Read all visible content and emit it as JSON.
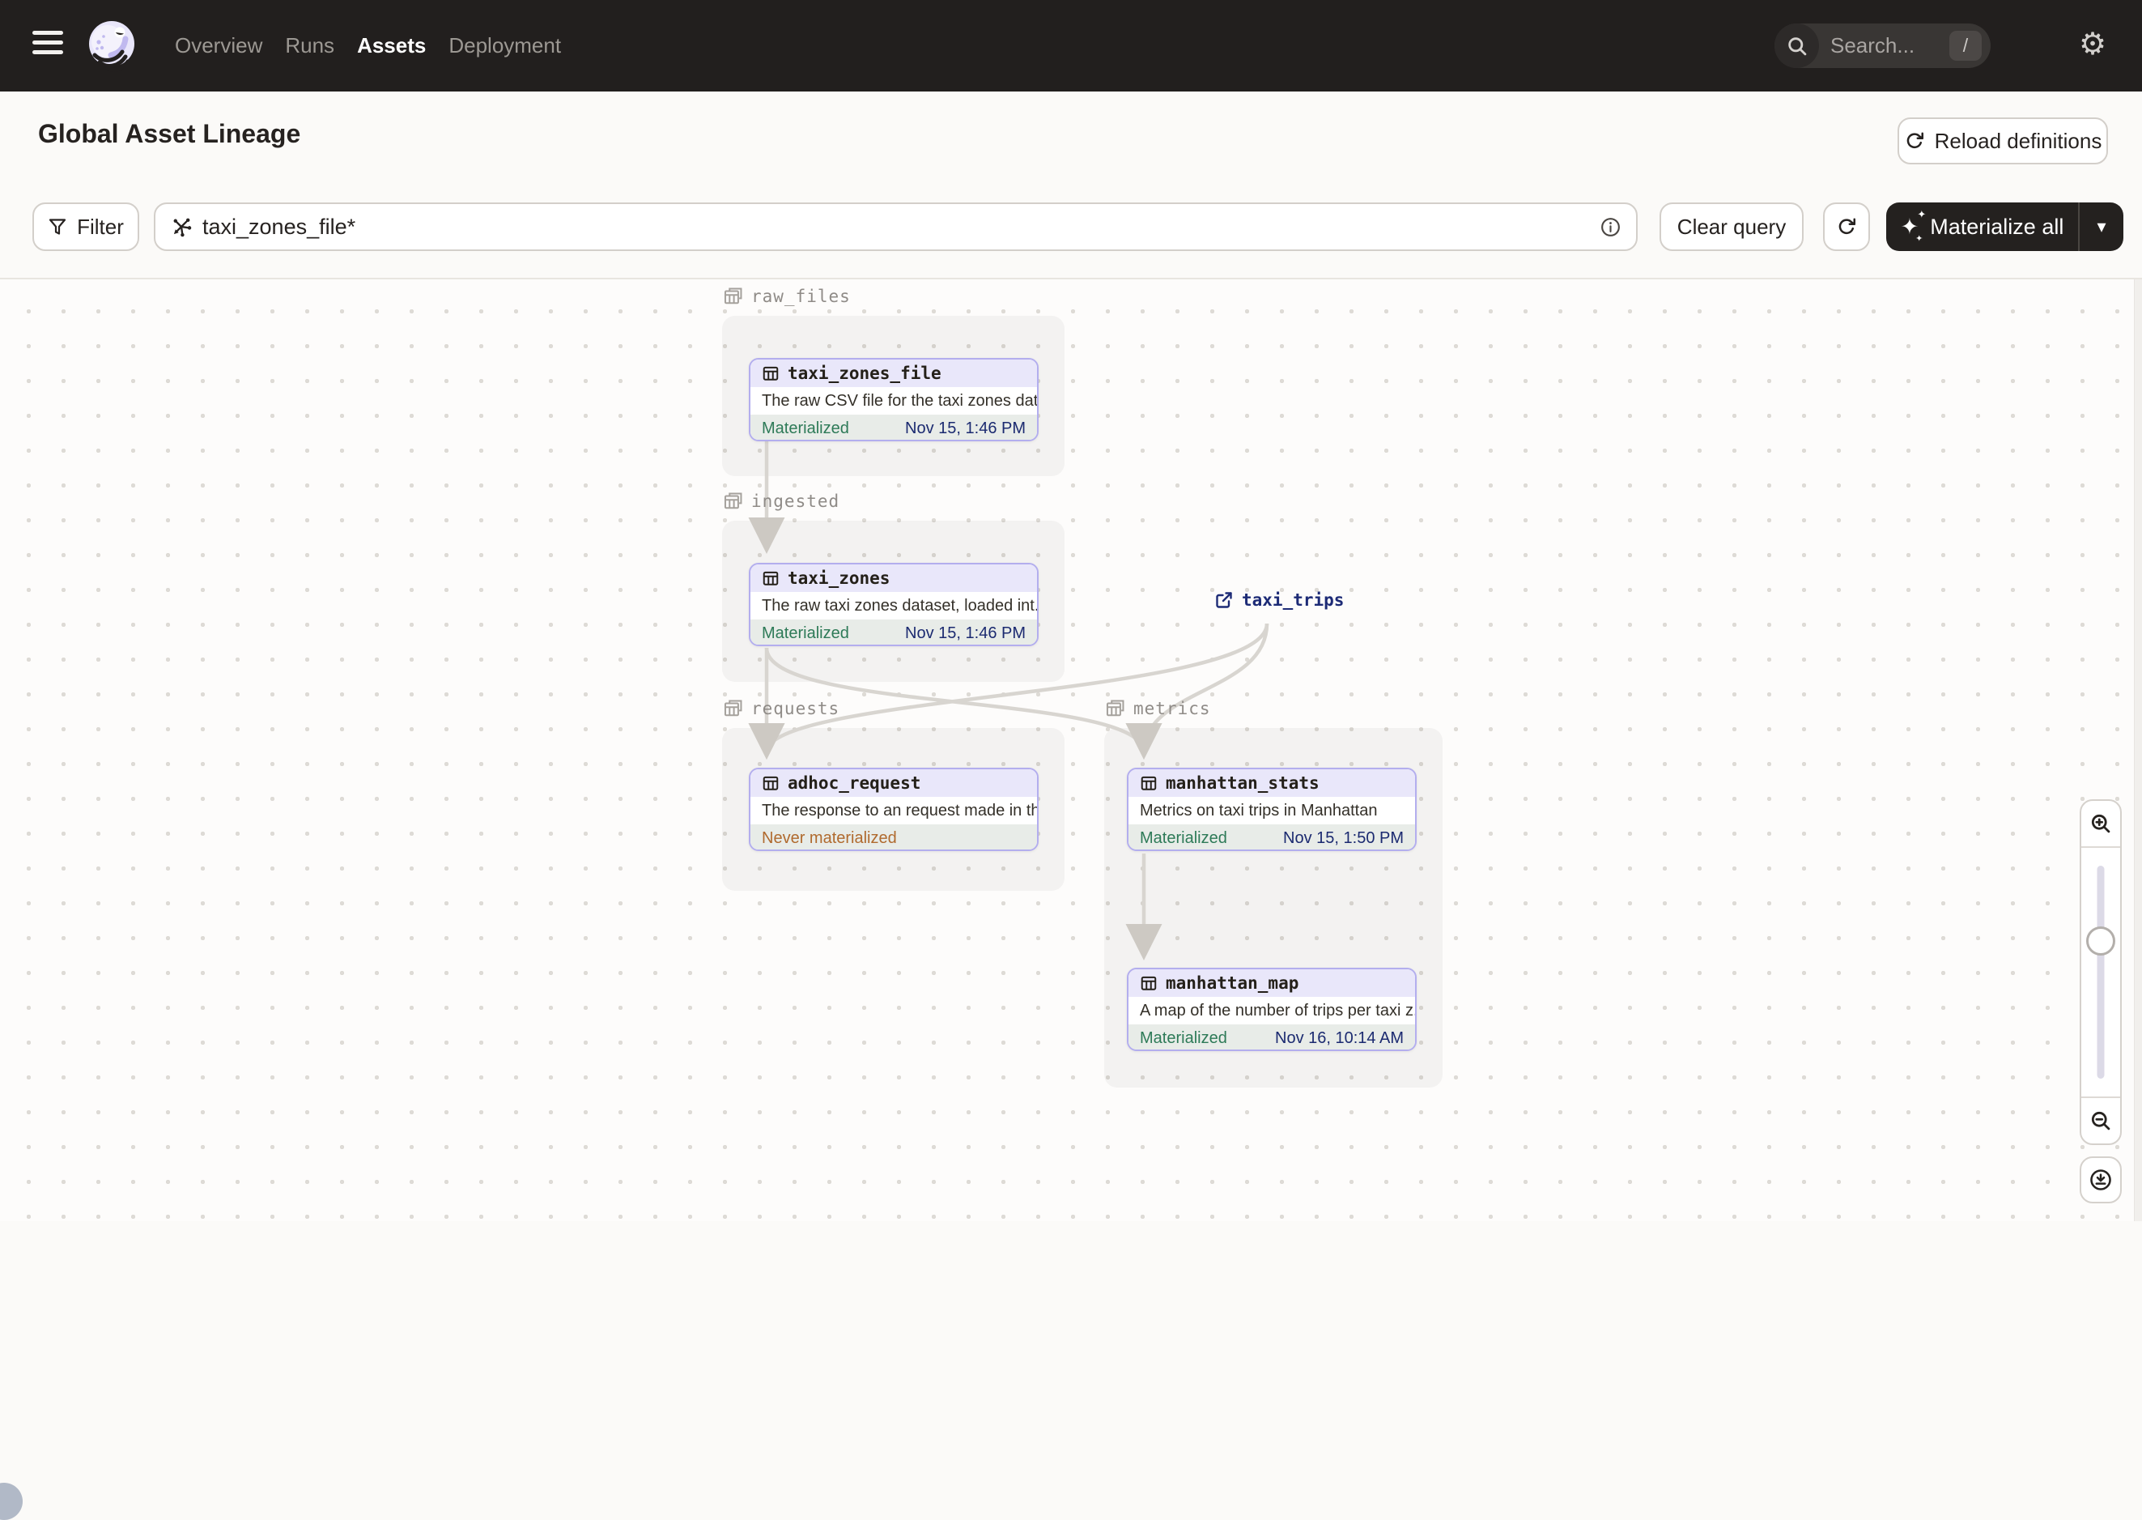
{
  "nav": {
    "items": [
      {
        "label": "Overview",
        "active": false
      },
      {
        "label": "Runs",
        "active": false
      },
      {
        "label": "Assets",
        "active": true
      },
      {
        "label": "Deployment",
        "active": false
      }
    ],
    "search": {
      "placeholder": "Search...",
      "shortcut": "/"
    }
  },
  "header": {
    "title": "Global Asset Lineage",
    "reload_button": "Reload definitions"
  },
  "toolbar": {
    "filter_button": "Filter",
    "query_value": "taxi_zones_file*",
    "clear_button": "Clear query",
    "materialize_button": "Materialize all"
  },
  "graph": {
    "groups": [
      {
        "name": "raw_files",
        "nodes": [
          {
            "name": "taxi_zones_file",
            "description": "The raw CSV file for the taxi zones dat...",
            "status": "Materialized",
            "timestamp": "Nov 15, 1:46 PM"
          }
        ]
      },
      {
        "name": "ingested",
        "nodes": [
          {
            "name": "taxi_zones",
            "description": "The raw taxi zones dataset, loaded int...",
            "status": "Materialized",
            "timestamp": "Nov 15, 1:46 PM"
          }
        ]
      },
      {
        "name": "requests",
        "nodes": [
          {
            "name": "adhoc_request",
            "description": "The response to an request made in th...",
            "status": "Never materialized",
            "timestamp": ""
          }
        ]
      },
      {
        "name": "metrics",
        "nodes": [
          {
            "name": "manhattan_stats",
            "description": "Metrics on taxi trips in Manhattan",
            "status": "Materialized",
            "timestamp": "Nov 15, 1:50 PM"
          },
          {
            "name": "manhattan_map",
            "description": "A map of the number of trips per taxi z...",
            "status": "Materialized",
            "timestamp": "Nov 16, 10:14 AM"
          }
        ]
      }
    ],
    "external_assets": [
      {
        "name": "taxi_trips"
      }
    ]
  },
  "colors": {
    "nav_background": "#221f1e",
    "materialized_green": "#2d7a57",
    "never_materialized_amber": "#b06a2e",
    "timestamp_navy": "#1b2a70",
    "node_border_lavender": "#b3aeee",
    "node_header_lavender": "#e9e7fa",
    "edge_gray": "#d8d5d0"
  }
}
